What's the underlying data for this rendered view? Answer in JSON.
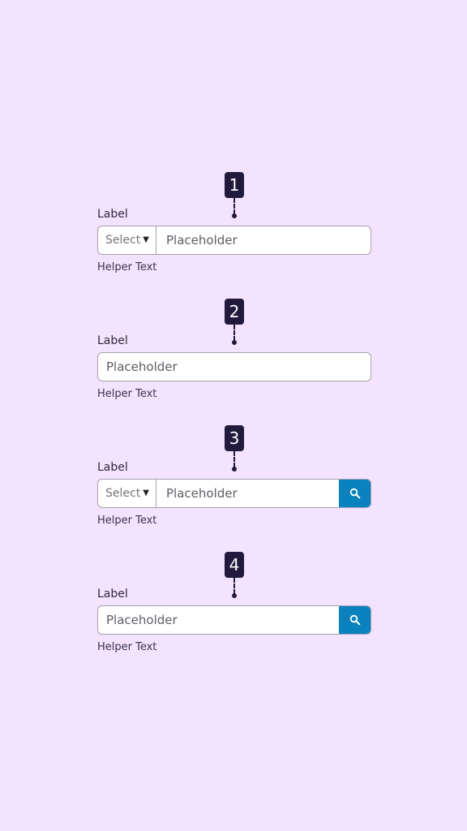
{
  "colors": {
    "background": "#F3E3FE",
    "badge": "#221A3C",
    "search_button": "#0B82BE",
    "field_border": "#A6A2AD"
  },
  "variants": [
    {
      "number": "1",
      "label": "Label",
      "select": "Select",
      "placeholder": "Placeholder",
      "helper": "Helper Text"
    },
    {
      "number": "2",
      "label": "Label",
      "placeholder": "Placeholder",
      "helper": "Helper Text"
    },
    {
      "number": "3",
      "label": "Label",
      "select": "Select",
      "placeholder": "Placeholder",
      "helper": "Helper Text",
      "button_icon": "search-icon"
    },
    {
      "number": "4",
      "label": "Label",
      "placeholder": "Placeholder",
      "helper": "Helper Text",
      "button_icon": "search-icon"
    }
  ]
}
